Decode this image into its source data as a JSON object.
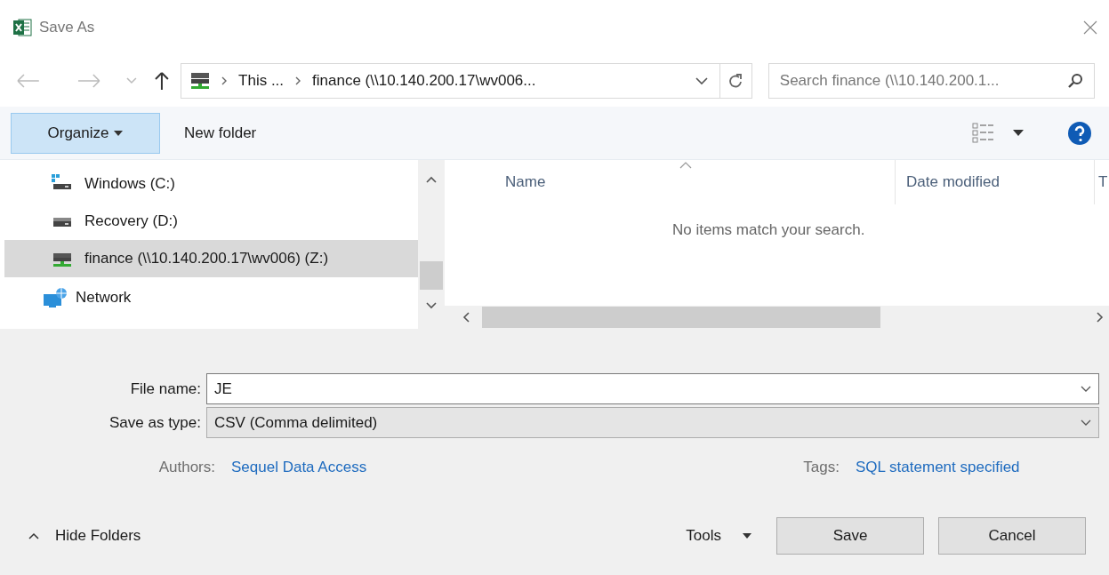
{
  "window": {
    "title": "Save As"
  },
  "address_bar": {
    "segments": [
      "This ...",
      "finance (\\\\10.140.200.17\\wv006..."
    ]
  },
  "search": {
    "placeholder": "Search finance (\\\\10.140.200.1..."
  },
  "toolbar": {
    "organize": "Organize",
    "new_folder": "New folder"
  },
  "navigation": [
    {
      "label": "Windows (C:)",
      "kind": "system-drive",
      "selected": false
    },
    {
      "label": "Recovery (D:)",
      "kind": "drive",
      "selected": false
    },
    {
      "label": "finance (\\\\10.140.200.17\\wv006) (Z:)",
      "kind": "network-drive",
      "selected": true
    },
    {
      "label": "Network",
      "kind": "network",
      "selected": false
    }
  ],
  "file_list": {
    "columns": [
      "Name",
      "Date modified",
      "T"
    ],
    "empty_message": "No items match your search."
  },
  "form": {
    "file_name_label": "File name:",
    "file_name": "JE",
    "type_label": "Save as type:",
    "type": "CSV (Comma delimited)"
  },
  "properties": [
    {
      "label": "Authors:",
      "value": "Sequel Data Access"
    },
    {
      "label": "Tags:",
      "value": "SQL statement specified"
    }
  ],
  "footer": {
    "hide_folders": "Hide Folders",
    "tools": "Tools",
    "buttons": [
      "Save",
      "Cancel"
    ]
  }
}
